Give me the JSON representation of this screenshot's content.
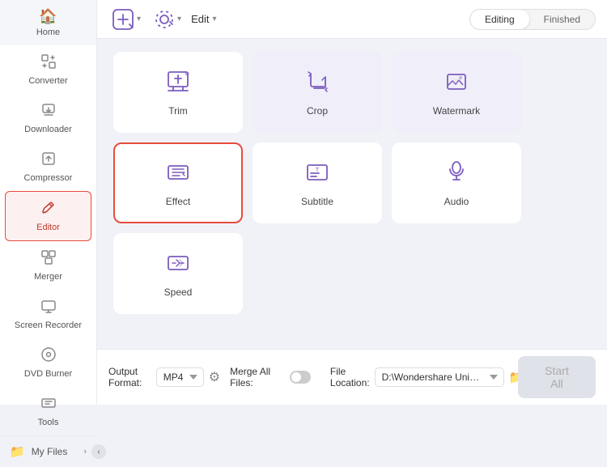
{
  "sidebar": {
    "items": [
      {
        "id": "home",
        "label": "Home",
        "icon": "🏠"
      },
      {
        "id": "converter",
        "label": "Converter",
        "icon": "🔄"
      },
      {
        "id": "downloader",
        "label": "Downloader",
        "icon": "⬇️"
      },
      {
        "id": "compressor",
        "label": "Compressor",
        "icon": "🗜"
      },
      {
        "id": "editor",
        "label": "Editor",
        "icon": "✂️",
        "active": true
      },
      {
        "id": "merger",
        "label": "Merger",
        "icon": "⊞"
      },
      {
        "id": "screen-recorder",
        "label": "Screen Recorder",
        "icon": "🖥"
      },
      {
        "id": "dvd-burner",
        "label": "DVD Burner",
        "icon": "💿"
      },
      {
        "id": "tools",
        "label": "Tools",
        "icon": "🛠"
      }
    ],
    "bottom": {
      "label": "My Files",
      "icon": "📁"
    },
    "collapse_char": "‹"
  },
  "toolbar": {
    "add_label": "＋",
    "edit_label": "Edit",
    "edit_arrow": "▾",
    "tabs": [
      {
        "id": "editing",
        "label": "Editing",
        "active": true
      },
      {
        "id": "finished",
        "label": "Finished",
        "active": false
      }
    ]
  },
  "grid": {
    "cards": [
      {
        "id": "trim",
        "label": "Trim",
        "icon": "trim",
        "highlighted": false
      },
      {
        "id": "crop",
        "label": "Crop",
        "icon": "crop",
        "highlighted": false
      },
      {
        "id": "watermark",
        "label": "Watermark",
        "icon": "watermark",
        "highlighted": false
      },
      {
        "id": "effect",
        "label": "Effect",
        "icon": "effect",
        "highlighted": true
      },
      {
        "id": "subtitle",
        "label": "Subtitle",
        "icon": "subtitle",
        "highlighted": false
      },
      {
        "id": "audio",
        "label": "Audio",
        "icon": "audio",
        "highlighted": false
      },
      {
        "id": "speed",
        "label": "Speed",
        "icon": "speed",
        "highlighted": false
      }
    ]
  },
  "bottom_bar": {
    "output_format_label": "Output Format:",
    "output_format_value": "MP4",
    "merge_label": "Merge All Files:",
    "file_location_label": "File Location:",
    "file_location_value": "D:\\Wondershare UniConverter",
    "start_btn_label": "Start All"
  },
  "colors": {
    "accent": "#7c5cbf",
    "active_sidebar": "#e74c3c",
    "highlight_border": "#e74c3c",
    "disabled_btn": "#e0e2ea",
    "disabled_text": "#aaaaaa"
  }
}
